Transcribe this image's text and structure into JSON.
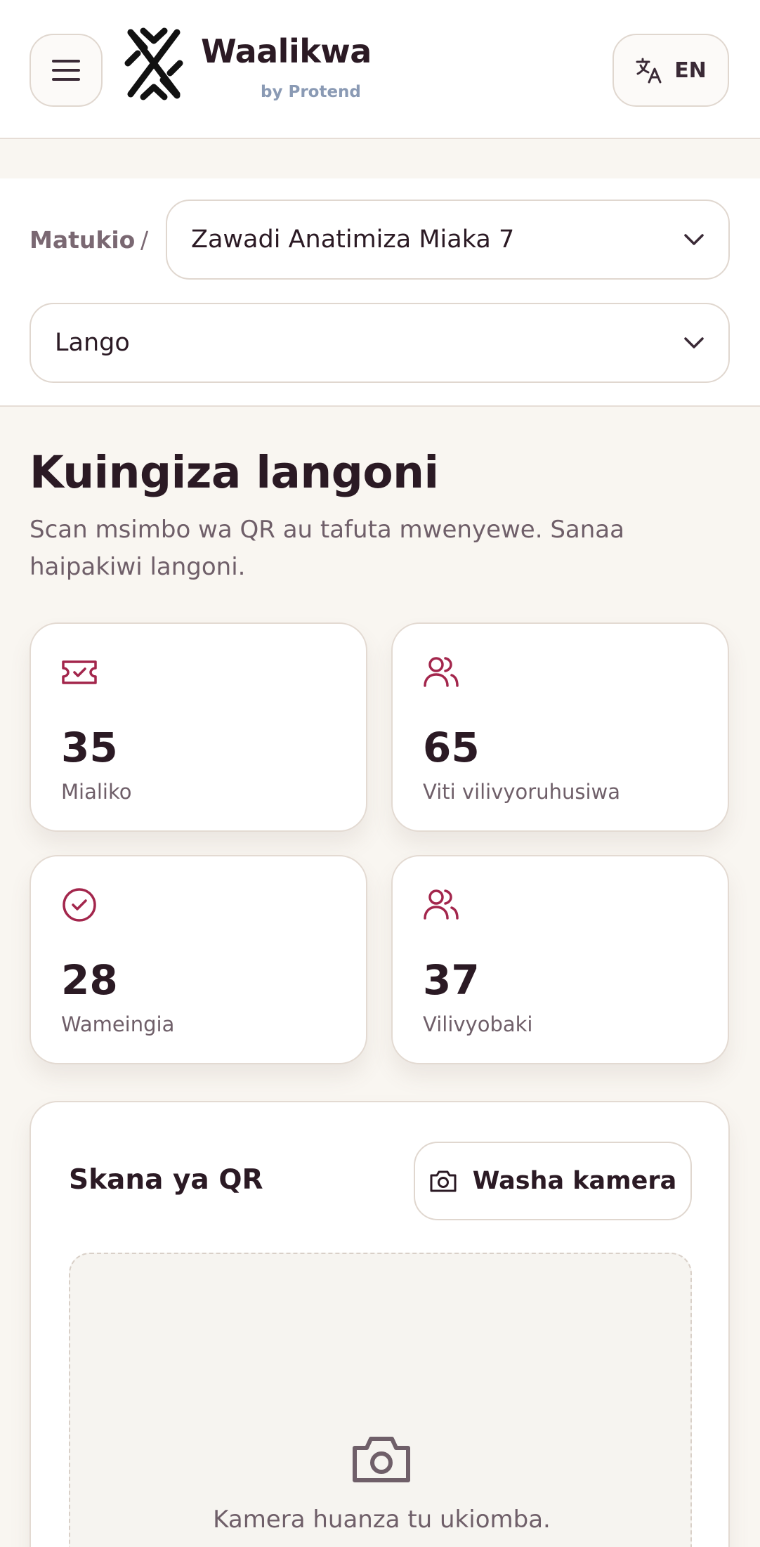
{
  "header": {
    "brand_name": "Waalikwa",
    "brand_sub": "by Protend",
    "language": "EN",
    "icons": {
      "menu": "hamburger-menu-icon",
      "translate": "translate-icon",
      "logo": "waalikwa-logo"
    }
  },
  "selectors": {
    "breadcrumb": "Matukio",
    "separator": "/",
    "event": "Zawadi Anatimiza Miaka 7",
    "gate": "Lango"
  },
  "page": {
    "title": "Kuingiza langoni",
    "description": "Scan msimbo wa QR au tafuta mwenyewe. Sanaa haipakiwi langoni."
  },
  "stats": [
    {
      "value": "35",
      "label": "Mialiko",
      "icon": "ticket-check-icon"
    },
    {
      "value": "65",
      "label": "Viti vilivyoruhusiwa",
      "icon": "users-icon"
    },
    {
      "value": "28",
      "label": "Wameingia",
      "icon": "check-circle-icon"
    },
    {
      "value": "37",
      "label": "Vilivyobaki",
      "icon": "users-icon"
    }
  ],
  "scanner": {
    "title": "Skana ya QR",
    "button_label": "Washa kamera",
    "hint": "Kamera huanza tu ukiomba."
  },
  "colors": {
    "accent": "#a3264c",
    "text": "#2b1a24",
    "muted": "#6f5f69",
    "background": "#f9f6f1"
  }
}
